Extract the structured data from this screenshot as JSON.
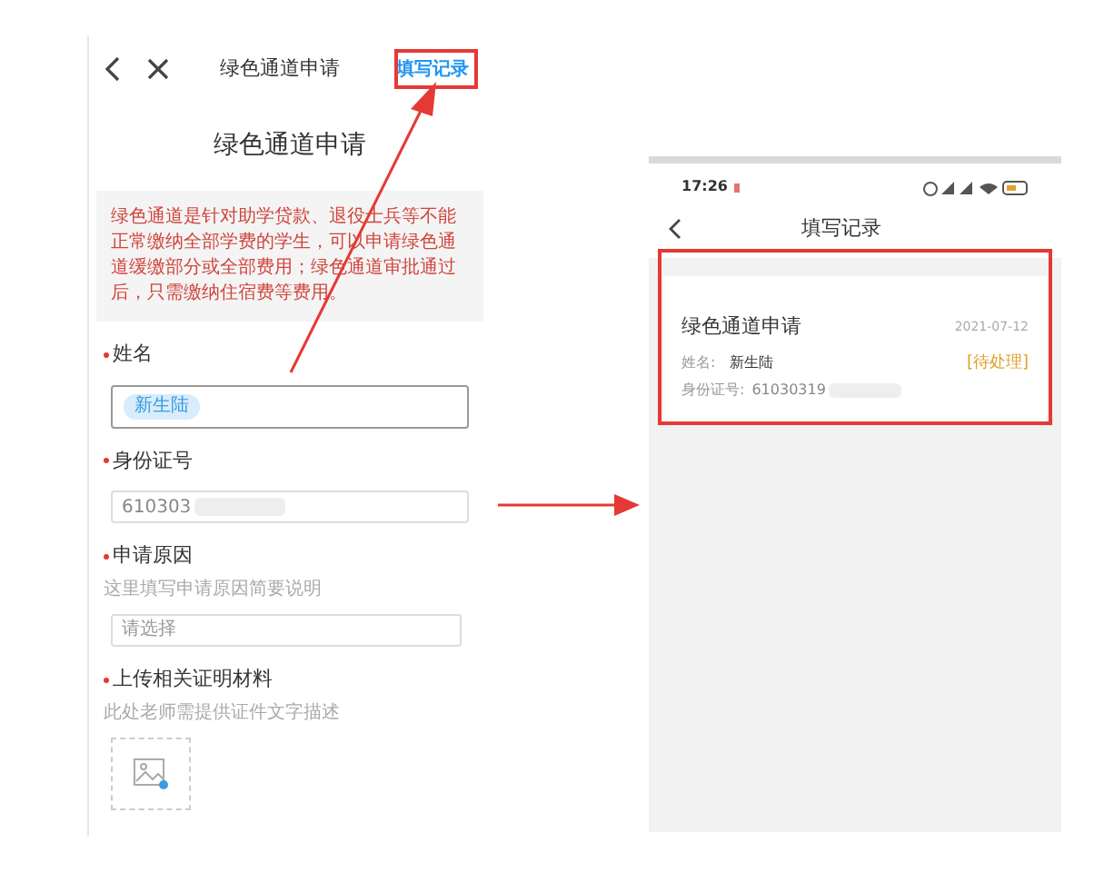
{
  "left_phone": {
    "nav": {
      "title": "绿色通道申请",
      "link": "填写记录"
    },
    "page_title": "绿色通道申请",
    "notice": "绿色通道是针对助学贷款、退役士兵等不能正常缴纳全部学费的学生，可以申请绿色通道缓缴部分或全部费用；绿色通道审批通过后，只需缴纳住宿费等费用。",
    "fields": [
      {
        "kind": "tag",
        "label": "姓名",
        "required": true,
        "value": "新生陆"
      },
      {
        "kind": "text",
        "label": "身份证号",
        "required": true,
        "value": "610303"
      },
      {
        "kind": "select",
        "label": "申请原因",
        "required": true,
        "hint": "这里填写申请原因简要说明",
        "placeholder": "请选择"
      },
      {
        "kind": "upload",
        "label": "上传相关证明材料",
        "required": true,
        "hint": "此处老师需提供证件文字描述"
      }
    ]
  },
  "right_phone": {
    "status_bar": {
      "time": "17:26"
    },
    "nav": {
      "title": "填写记录"
    },
    "record": {
      "title": "绿色通道申请",
      "date": "2021-07-12",
      "name_label": "姓名:",
      "name": "新生陆",
      "status": "[待处理]",
      "id_label": "身份证号:",
      "id": "61030319"
    }
  }
}
